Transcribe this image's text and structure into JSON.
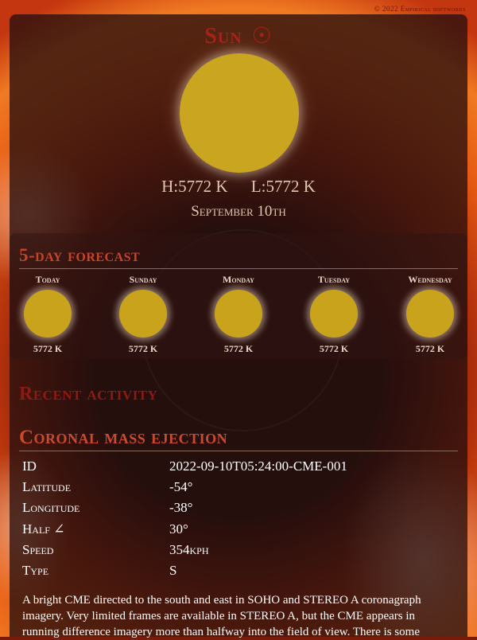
{
  "credit": "© 2022 Empirical softworks",
  "sun": {
    "title": "Sun",
    "symbol": "☉",
    "high": "H:5772 K",
    "low": "L:5772 K",
    "date": "September 10th"
  },
  "forecast": {
    "title": "5-day forecast",
    "days": [
      {
        "name": "Today",
        "temp": "5772 K"
      },
      {
        "name": "Sunday",
        "temp": "5772 K"
      },
      {
        "name": "Monday",
        "temp": "5772 K"
      },
      {
        "name": "Tuesday",
        "temp": "5772 K"
      },
      {
        "name": "Wednesday",
        "temp": "5772 K"
      }
    ]
  },
  "recent": {
    "title": "Recent activity"
  },
  "cme": {
    "title": "Coronal mass ejection",
    "rows": [
      {
        "key": "ID",
        "value": "2022-09-10T05:24:00-CME-001"
      },
      {
        "key": "Latitude",
        "value": "-54°"
      },
      {
        "key": "Longitude",
        "value": "-38°"
      },
      {
        "key": "Half ∠",
        "value": "30°"
      },
      {
        "key": "Speed",
        "value": "354kph"
      },
      {
        "key": "Type",
        "value": "S"
      }
    ],
    "description": "A bright CME directed to the south and east in SOHO and STEREO A coronagraph imagery. Very limited frames are available in STEREO A, but the CME appears in running difference imagery more than halfway into the field of view. There is some"
  },
  "colors": {
    "sun": "#caa51f",
    "accent": "#cc4a2c",
    "card": "#28100e"
  }
}
